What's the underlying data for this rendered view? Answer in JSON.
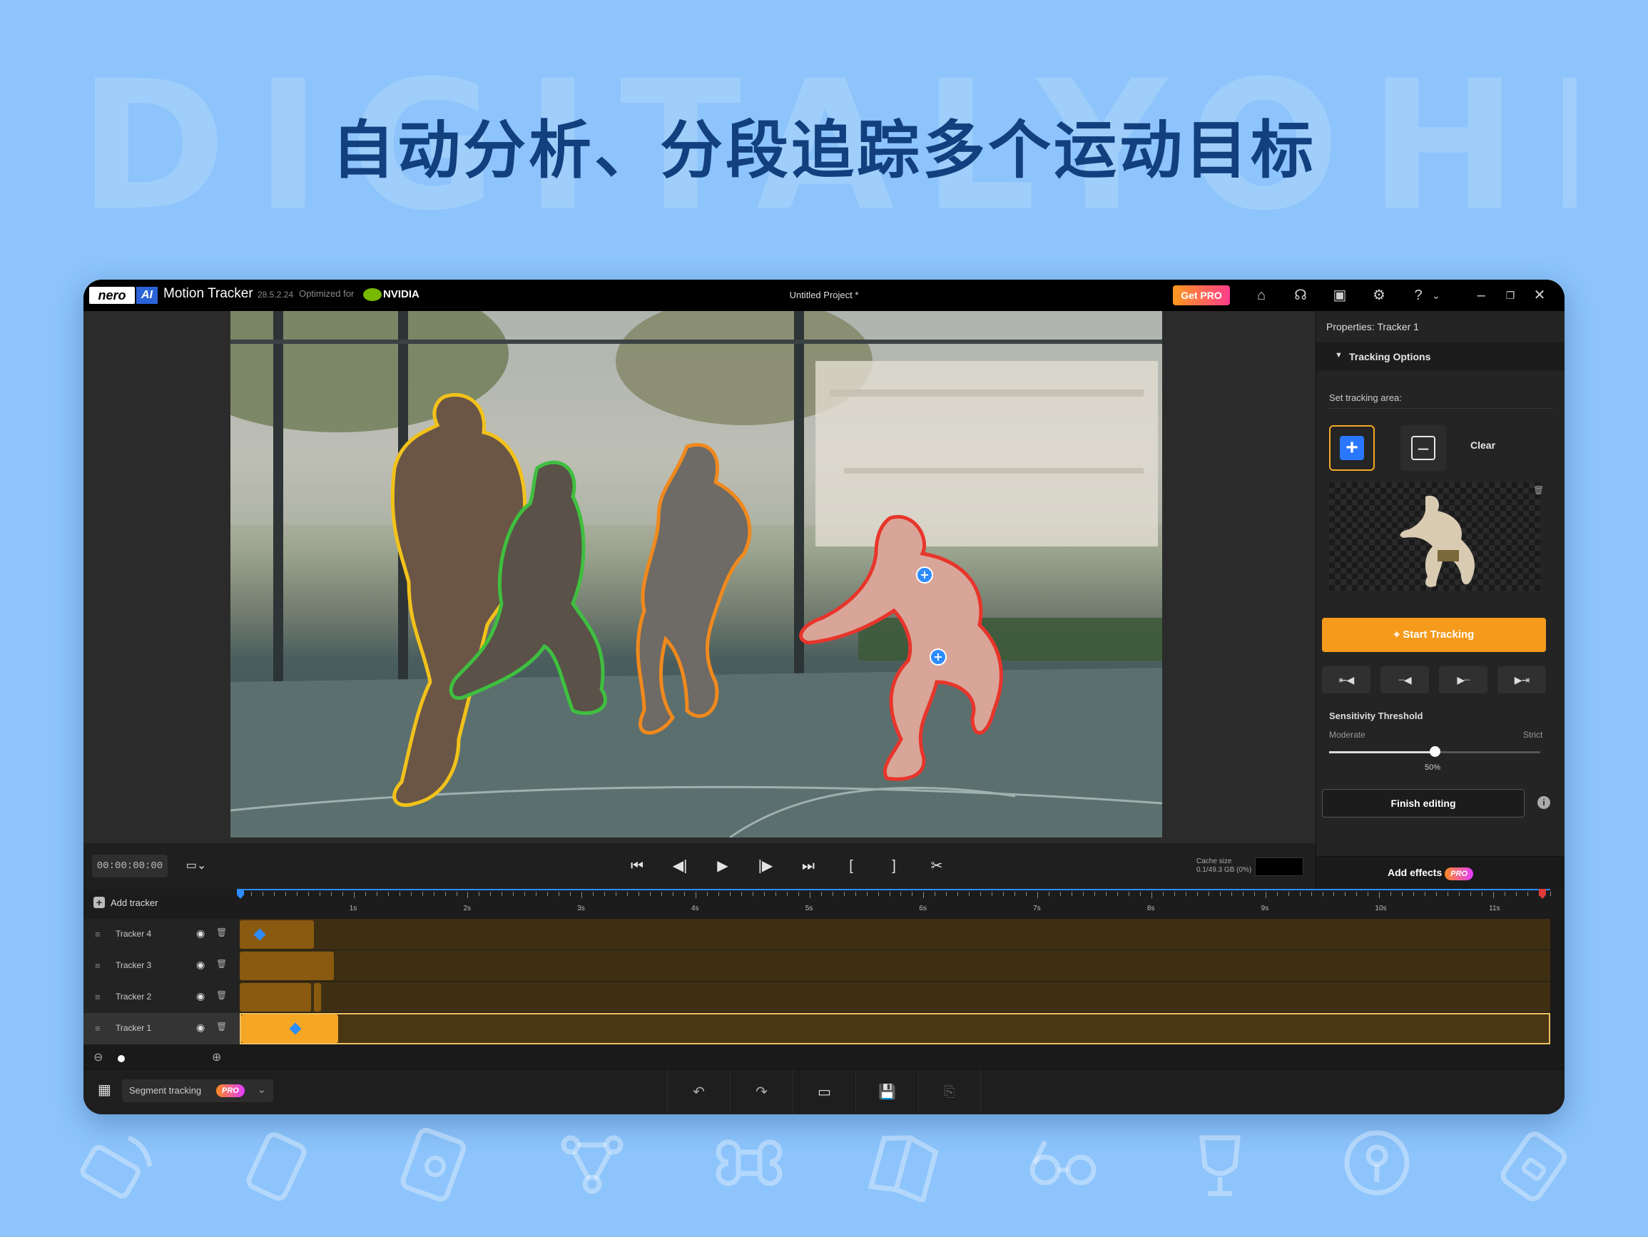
{
  "banner": {
    "watermark": "DIGITALYOHEE",
    "headline": "自动分析、分段追踪多个运动目标"
  },
  "titlebar": {
    "logo_nero": "nero",
    "logo_ai": "AI",
    "app_name": "Motion Tracker",
    "version": "28.5.2.24",
    "optimized_for": "Optimized for",
    "nvidia": "NVIDIA",
    "project_title": "Untitled Project *",
    "get_pro": "Get PRO",
    "icons": [
      "home-icon",
      "headset-icon",
      "gift-icon",
      "gear-icon",
      "help-icon",
      "chevron-down-icon",
      "minimize-icon",
      "restore-icon",
      "close-icon"
    ]
  },
  "player": {
    "timecode": "00:00:00:00",
    "cache_label": "Cache size",
    "cache_value": "0.1/49.3 GB (0%)",
    "controls": [
      "skip-start",
      "prev-frame",
      "play",
      "next-frame",
      "skip-end",
      "mark-in",
      "mark-out",
      "cut"
    ],
    "playhead_fraction": 0.0
  },
  "panel": {
    "title": "Properties: Tracker 1",
    "section": "Tracking Options",
    "set_area_label": "Set tracking area:",
    "clear": "Clear",
    "start_tracking": "Start Tracking",
    "sensitivity": {
      "title": "Sensitivity Threshold",
      "min_label": "Moderate",
      "max_label": "Strict",
      "value_label": "50%",
      "value": 0.5
    },
    "finish_editing": "Finish editing",
    "add_effects": "Add effects",
    "pro": "PRO"
  },
  "timeline": {
    "add_tracker": "Add tracker",
    "ruler": [
      "1s",
      "2s",
      "3s",
      "4s",
      "5s",
      "6s",
      "7s",
      "8s",
      "9s",
      "10s",
      "11s"
    ],
    "tracks": [
      {
        "name": "Tracker 4",
        "selected": false
      },
      {
        "name": "Tracker 3",
        "selected": false
      },
      {
        "name": "Tracker 2",
        "selected": false
      },
      {
        "name": "Tracker 1",
        "selected": true
      }
    ]
  },
  "bottombar": {
    "segment_tracking": "Segment tracking",
    "pro": "PRO"
  },
  "colors": {
    "accent_orange": "#f59a1b",
    "accent_blue": "#2d8cff",
    "outline_yellow": "#f2c21a",
    "outline_green": "#3fbf3f",
    "outline_orange": "#f0891d",
    "outline_red": "#e8352b"
  }
}
